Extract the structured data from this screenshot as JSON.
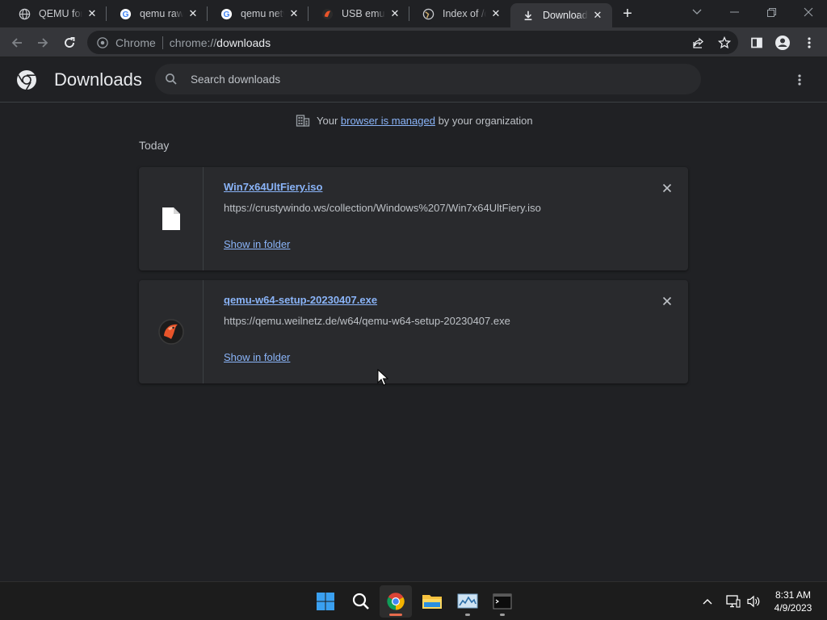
{
  "browser": {
    "tabs": [
      {
        "title": "QEMU for Windows",
        "favicon": "globe-icon"
      },
      {
        "title": "qemu raw e",
        "favicon": "google-g-icon"
      },
      {
        "title": "qemu netw",
        "favicon": "google-g-icon"
      },
      {
        "title": "USB emula",
        "favicon": "red-bird-icon"
      },
      {
        "title": "Index of /q",
        "favicon": "globe-icon"
      },
      {
        "title": "Downloads",
        "favicon": "download-icon",
        "active": true
      }
    ],
    "omnibox": {
      "chip_label": "Chrome",
      "url_scheme": "chrome://",
      "url_path": "downloads"
    }
  },
  "downloads_page": {
    "title": "Downloads",
    "search": {
      "placeholder": "Search downloads"
    },
    "managed_notice": {
      "prefix": "Your ",
      "link": "browser is managed",
      "suffix": " by your organization"
    },
    "section_label": "Today",
    "items": [
      {
        "filename": "Win7x64UltFiery.iso",
        "url": "https://crustywindo.ws/collection/Windows%207/Win7x64UltFiery.iso",
        "action": "Show in folder",
        "icon": "file-icon"
      },
      {
        "filename": "qemu-w64-setup-20230407.exe",
        "url": "https://qemu.weilnetz.de/w64/qemu-w64-setup-20230407.exe",
        "action": "Show in folder",
        "icon": "qemu-icon"
      }
    ]
  },
  "taskbar": {
    "apps": [
      "windows-start-icon",
      "search-icon",
      "chrome-icon",
      "file-explorer-icon",
      "task-manager-icon",
      "terminal-icon"
    ],
    "clock": {
      "time": "8:31 AM",
      "date": "4/9/2023"
    }
  },
  "colors": {
    "page_bg": "#202124",
    "card_bg": "#292a2d",
    "link": "#8ab4f8",
    "toolbar_bg": "#35363a"
  }
}
